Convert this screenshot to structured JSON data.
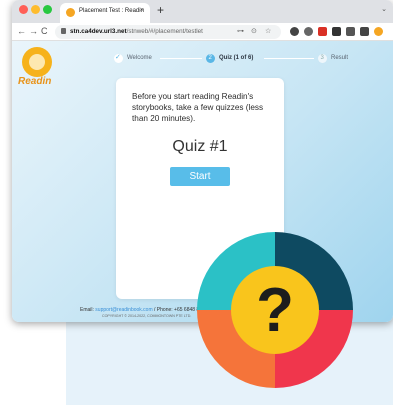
{
  "browser": {
    "tab_title": "Placement Test : Readin",
    "tab_close": "×",
    "new_tab": "+",
    "tab_chevron": "⌄",
    "nav_back": "←",
    "nav_forward": "→",
    "nav_reload": "C",
    "url_host": "stn.ca4dev.url3.net",
    "url_path": "/stnweb/#/placement/testlet",
    "omni_icons": [
      "⊶",
      "⊙",
      "☆"
    ]
  },
  "app": {
    "logo_text": "Readin"
  },
  "stepper": {
    "steps": [
      {
        "label": "Welcome",
        "state": "done"
      },
      {
        "label": "Quiz (1 of 6)",
        "state": "active",
        "number": "2"
      },
      {
        "label": "Result",
        "state": "pending",
        "number": "3"
      }
    ]
  },
  "card": {
    "intro": "Before you start reading Readin's storybooks, take a few quizzes (less than 20 minutes).",
    "quiz_title": "Quiz #1",
    "start_label": "Start"
  },
  "footer": {
    "email_label": "Email:",
    "email": "support@readinbook.com",
    "phone_text": "/ Phone: +65 6848 88",
    "copyright": "COPYRIGHT © 2014-2022, COMMONTOWN PTE LTD."
  },
  "badge": {
    "symbol": "?",
    "segment_colors": [
      "#0e4a61",
      "#f0364c",
      "#f5743a",
      "#2bc1c6"
    ],
    "center_color": "#f9c51c"
  },
  "colors": {
    "accent": "#58bde9",
    "brand": "#f6b21b"
  }
}
